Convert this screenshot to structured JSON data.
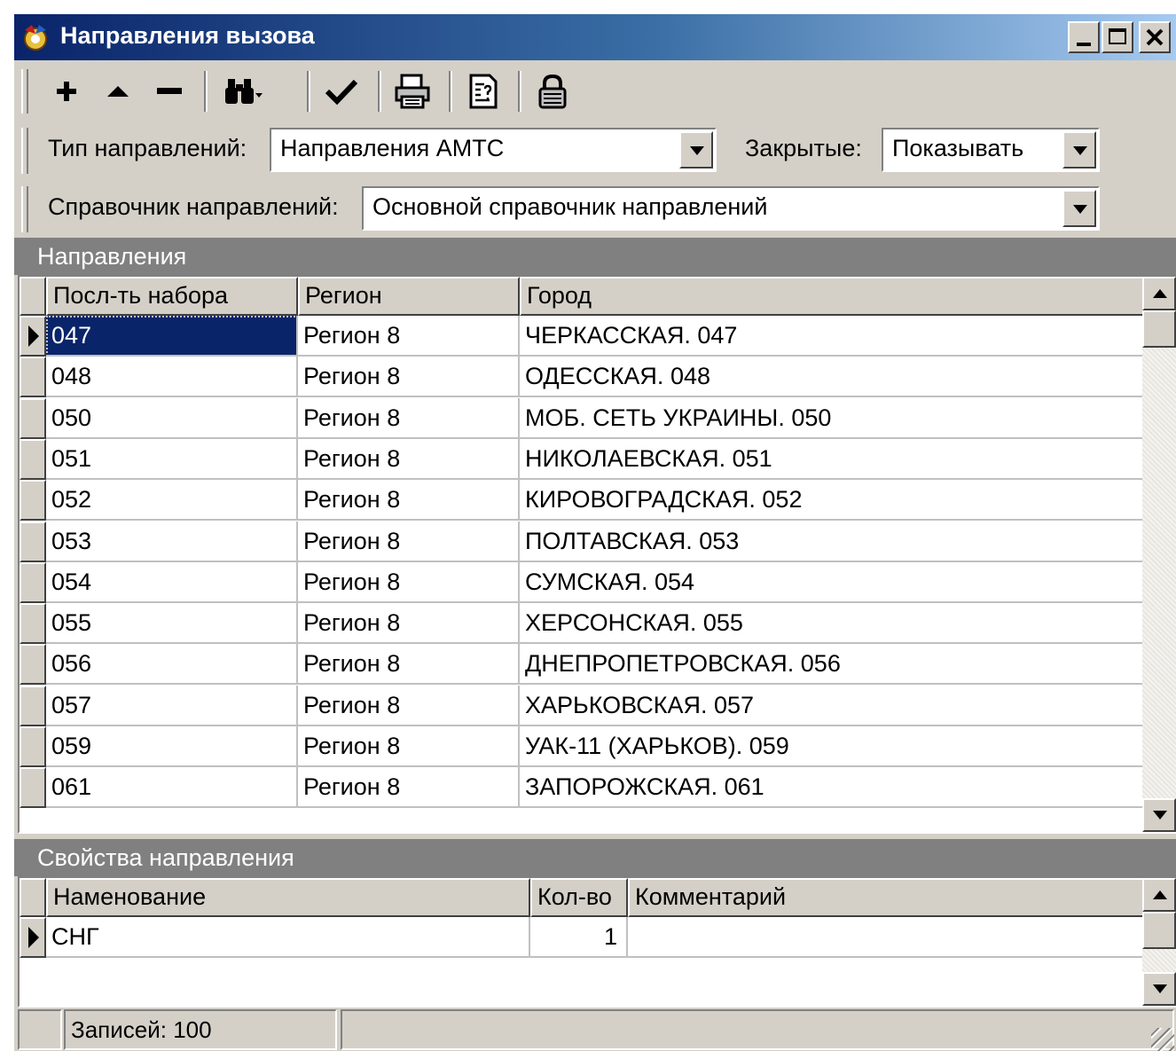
{
  "window": {
    "title": "Направления вызова"
  },
  "toolbar": {
    "buttons": [
      {
        "icon": "plus-icon"
      },
      {
        "icon": "move-up-icon"
      },
      {
        "icon": "minus-icon"
      },
      {
        "icon": "binoculars-icon"
      },
      {
        "icon": "check-icon"
      },
      {
        "icon": "printer-icon"
      },
      {
        "icon": "report-icon"
      },
      {
        "icon": "lock-icon"
      }
    ]
  },
  "filters": {
    "type_label": "Тип направлений:",
    "type_value": "Направления АМТС",
    "closed_label": "Закрытые:",
    "closed_value": "Показывать",
    "directory_label": "Справочник направлений:",
    "directory_value": "Основной справочник направлений"
  },
  "directions": {
    "section_title": "Направления",
    "columns": [
      "Посл-ть набора",
      "Регион",
      "Город"
    ],
    "rows": [
      [
        "047",
        "Регион 8",
        "ЧЕРКАССКАЯ. 047"
      ],
      [
        "048",
        "Регион 8",
        "ОДЕССКАЯ. 048"
      ],
      [
        "050",
        "Регион 8",
        "МОБ. СЕТЬ УКРАИНЫ. 050"
      ],
      [
        "051",
        "Регион 8",
        "НИКОЛАЕВСКАЯ. 051"
      ],
      [
        "052",
        "Регион 8",
        "КИРОВОГРАДСКАЯ. 052"
      ],
      [
        "053",
        "Регион 8",
        "ПОЛТАВСКАЯ. 053"
      ],
      [
        "054",
        "Регион 8",
        "СУМСКАЯ. 054"
      ],
      [
        "055",
        "Регион 8",
        "ХЕРСОНСКАЯ. 055"
      ],
      [
        "056",
        "Регион 8",
        "ДНЕПРОПЕТРОВСКАЯ. 056"
      ],
      [
        "057",
        "Регион 8",
        "ХАРЬКОВСКАЯ. 057"
      ],
      [
        "059",
        "Регион 8",
        "УАК-11 (ХАРЬКОВ). 059"
      ],
      [
        "061",
        "Регион 8",
        "ЗАПОРОЖСКАЯ. 061"
      ]
    ]
  },
  "properties": {
    "section_title": "Свойства направления",
    "columns": [
      "Наменование",
      "Кол-во",
      "Комментарий"
    ],
    "rows": [
      [
        "СНГ",
        "1",
        ""
      ]
    ]
  },
  "status": {
    "records": "Записей: 100"
  }
}
